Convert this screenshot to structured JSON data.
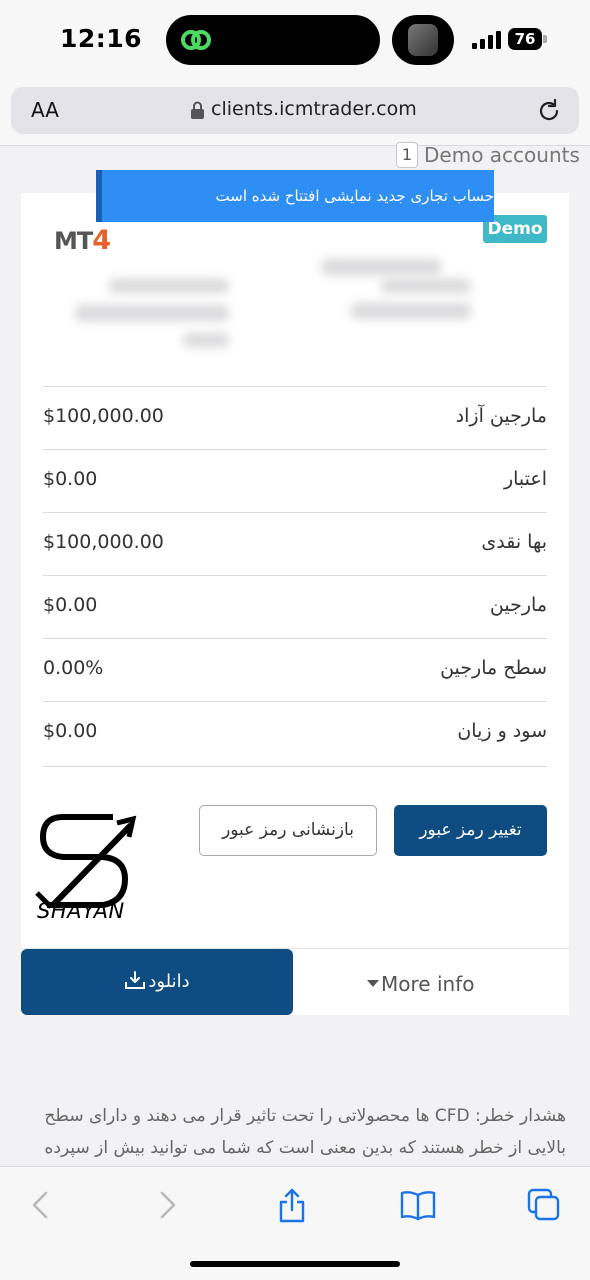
{
  "status_bar": {
    "time": "12:16",
    "battery": "76"
  },
  "browser": {
    "text_size_label": "AA",
    "url": "clients.icmtrader.com"
  },
  "accounts_header": {
    "count": "1",
    "label": "Demo accounts"
  },
  "toast": {
    "message": "حساب تجاری جدید نمایشی افتتاح شده است"
  },
  "account_card": {
    "platform_logo_prefix": "MT",
    "platform_logo_number": "4",
    "type_badge": "Demo",
    "rows": [
      {
        "label": "مارجین آزاد",
        "value": "$100,000.00"
      },
      {
        "label": "اعتبار",
        "value": "$0.00"
      },
      {
        "label": "بها نقدی",
        "value": "$100,000.00"
      },
      {
        "label": "مارجین",
        "value": "$0.00"
      },
      {
        "label": "سطح مارجین",
        "value": "0.00%"
      },
      {
        "label": "سود و زیان",
        "value": "$0.00"
      }
    ],
    "change_password_label": "تغییر رمز عبور",
    "reset_password_label": "بازنشانی رمز عبور",
    "watermark_text": "SHAYAN",
    "download_label": "دانلود",
    "more_info_label": "More info"
  },
  "risk_warning": "هشدار خطر: CFD ها محصولاتی را تحت تاثیر قرار می دهند و دارای سطح بالایی از خطر هستند که بدین معنی است که شما می توانید بیش از سپرده",
  "colors": {
    "primary": "#0f4c81",
    "toast": "#2f8ef4",
    "badge": "#3fb9c7",
    "mt4_accent": "#e8612c"
  }
}
